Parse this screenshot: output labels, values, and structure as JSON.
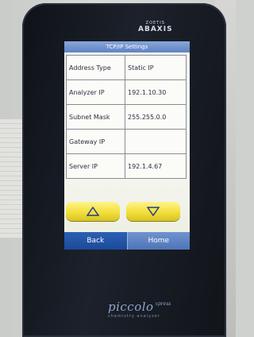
{
  "device": {
    "brand_small": "ZOETIS",
    "brand_name": "ABAXIS",
    "logo_name": "piccolo",
    "logo_suffix": "xpress",
    "logo_sub": "chemistry analyzer"
  },
  "screen": {
    "title": "TCP/IP Settings",
    "rows": [
      {
        "label": "Address Type",
        "value": "Static IP"
      },
      {
        "label": "Analyzer IP",
        "value": "192.1.10.30"
      },
      {
        "label": "Subnet Mask",
        "value": "255.255.0.0"
      },
      {
        "label": "Gateway IP",
        "value": ""
      },
      {
        "label": "Server IP",
        "value": "192.1.4.67"
      }
    ],
    "up_icon": "triangle-up-icon",
    "down_icon": "triangle-down-icon",
    "back_label": "Back",
    "home_label": "Home"
  },
  "colors": {
    "title_bar": "#5f82c5",
    "arrow_button": "#f2df3c",
    "back_button": "#1c4a9a",
    "home_button": "#4f75b9",
    "device_body": "#1c212b"
  }
}
